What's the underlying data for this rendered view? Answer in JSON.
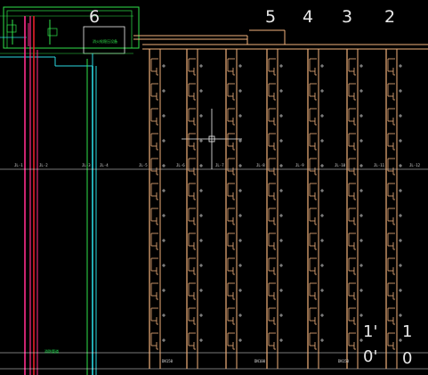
{
  "drawing": {
    "background": "#000000",
    "colors": {
      "riser": "#f2b27c",
      "magenta": "#ff2d8c",
      "red": "#e8202a",
      "cyan": "#2ad8e0",
      "green": "#2fe24a",
      "white": "#f0f0f0"
    },
    "column_numbers": [
      "6",
      "5",
      "4",
      "3",
      "2"
    ],
    "level_marks": [
      "1'",
      "1",
      "0'",
      "0"
    ],
    "equipment_label": "消火栓稳压设备",
    "riser_tags": [
      "JL-1",
      "JL-2",
      "JL-3",
      "JL-4",
      "JL-5",
      "JL-6",
      "JL-7",
      "JL-8",
      "JL-9",
      "JL-10",
      "JL-11",
      "JL-12"
    ],
    "bottom_labels": [
      "DN150",
      "DN100",
      "DN150"
    ],
    "branch_note": "消防管道",
    "cursor": "crosshair"
  }
}
